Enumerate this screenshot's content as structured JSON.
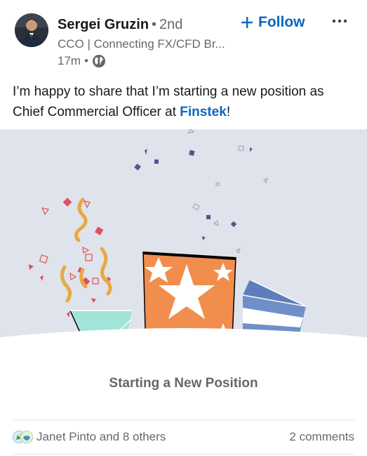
{
  "post": {
    "author": {
      "name": "Sergei Gruzin",
      "separator": "•",
      "degree": "2nd",
      "headline": "CCO | Connecting FX/CFD Br...",
      "time": "17m",
      "meta_separator": "•",
      "visibility_icon": "globe-icon"
    },
    "follow_label": "Follow",
    "more_icon": "ellipsis-icon",
    "text_before": "I’m happy to share that I’m starting a new position as Chief Commercial Officer at ",
    "company_link": "Finstek",
    "text_after": "!",
    "banner": {
      "caption": "Starting a New Position",
      "colors": {
        "background": "#dfe3ec",
        "orange_box": "#f28e4d",
        "teal_box": "#a3e4d9",
        "blue_box": "#6f8fc8",
        "confetti_red": "#e2505a",
        "streamer_yellow": "#e8a940",
        "confetti_purple": "#5f4f8c"
      }
    },
    "social": {
      "reactions_text": "Janet Pinto and 8 others",
      "reaction_icons": [
        "celebrate-icon",
        "support-icon"
      ],
      "comments_text": "2 comments"
    }
  }
}
